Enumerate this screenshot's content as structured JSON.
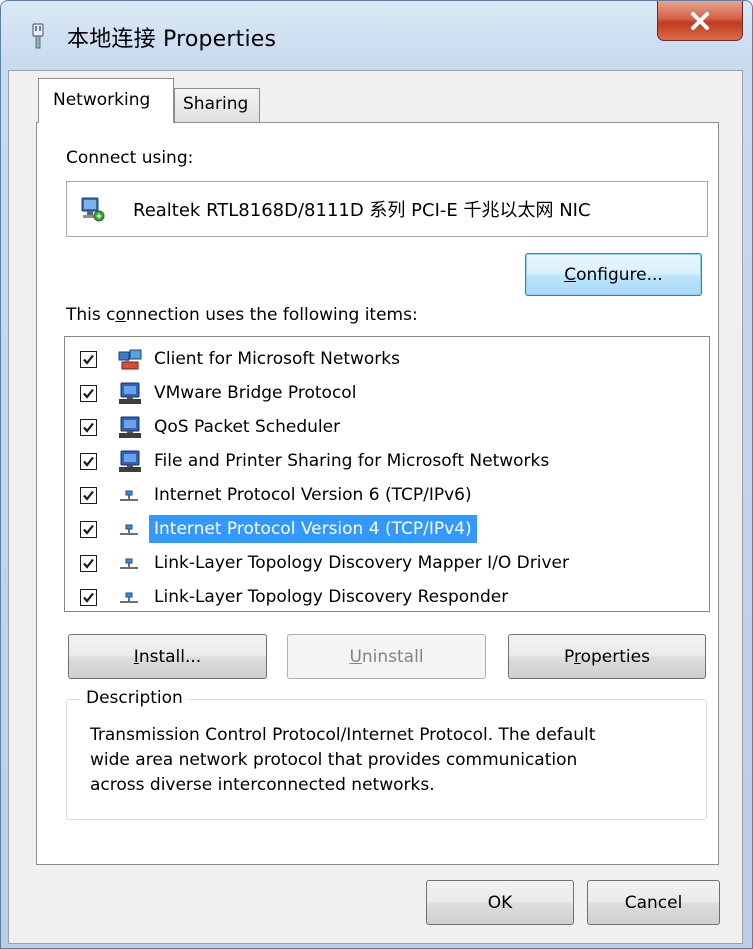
{
  "window": {
    "title": "本地连接 Properties"
  },
  "tabs": [
    {
      "label": "Networking",
      "active": true
    },
    {
      "label": "Sharing",
      "active": false
    }
  ],
  "networking": {
    "connect_using_label": "Connect using:",
    "adapter_name": "Realtek RTL8168D/8111D 系列 PCI-E 千兆以太网 NIC",
    "configure_button": {
      "pre": "",
      "mnemonic": "C",
      "post": "onfigure..."
    },
    "items_label": {
      "pre": "This c",
      "mnemonic": "o",
      "post": "nnection uses the following items:"
    },
    "items": [
      {
        "label": "Client for Microsoft Networks",
        "checked": true,
        "icon": "network-client-icon",
        "selected": false
      },
      {
        "label": "VMware Bridge Protocol",
        "checked": true,
        "icon": "network-service-icon",
        "selected": false
      },
      {
        "label": "QoS Packet Scheduler",
        "checked": true,
        "icon": "network-service-icon",
        "selected": false
      },
      {
        "label": "File and Printer Sharing for Microsoft Networks",
        "checked": true,
        "icon": "network-service-icon",
        "selected": false
      },
      {
        "label": "Internet Protocol Version 6 (TCP/IPv6)",
        "checked": true,
        "icon": "network-protocol-icon",
        "selected": false
      },
      {
        "label": "Internet Protocol Version 4 (TCP/IPv4)",
        "checked": true,
        "icon": "network-protocol-icon",
        "selected": true
      },
      {
        "label": "Link-Layer Topology Discovery Mapper I/O Driver",
        "checked": true,
        "icon": "network-protocol-icon",
        "selected": false
      },
      {
        "label": "Link-Layer Topology Discovery Responder",
        "checked": true,
        "icon": "network-protocol-icon",
        "selected": false
      }
    ],
    "install_button": {
      "pre": "",
      "mnemonic": "I",
      "post": "nstall..."
    },
    "uninstall_button": {
      "pre": "",
      "mnemonic": "U",
      "post": "ninstall"
    },
    "properties_button": {
      "pre": "P",
      "mnemonic": "r",
      "post": "operties"
    },
    "description": {
      "legend": "Description",
      "line1": "Transmission Control Protocol/Internet Protocol. The default",
      "line2": "wide area network protocol that provides communication",
      "line3": "across diverse interconnected networks."
    }
  },
  "footer": {
    "ok_label": "OK",
    "cancel_label": "Cancel"
  },
  "colors": {
    "selection": "#3399ff",
    "close_button": "#c7432a",
    "focus_border": "#3c7fb1"
  }
}
